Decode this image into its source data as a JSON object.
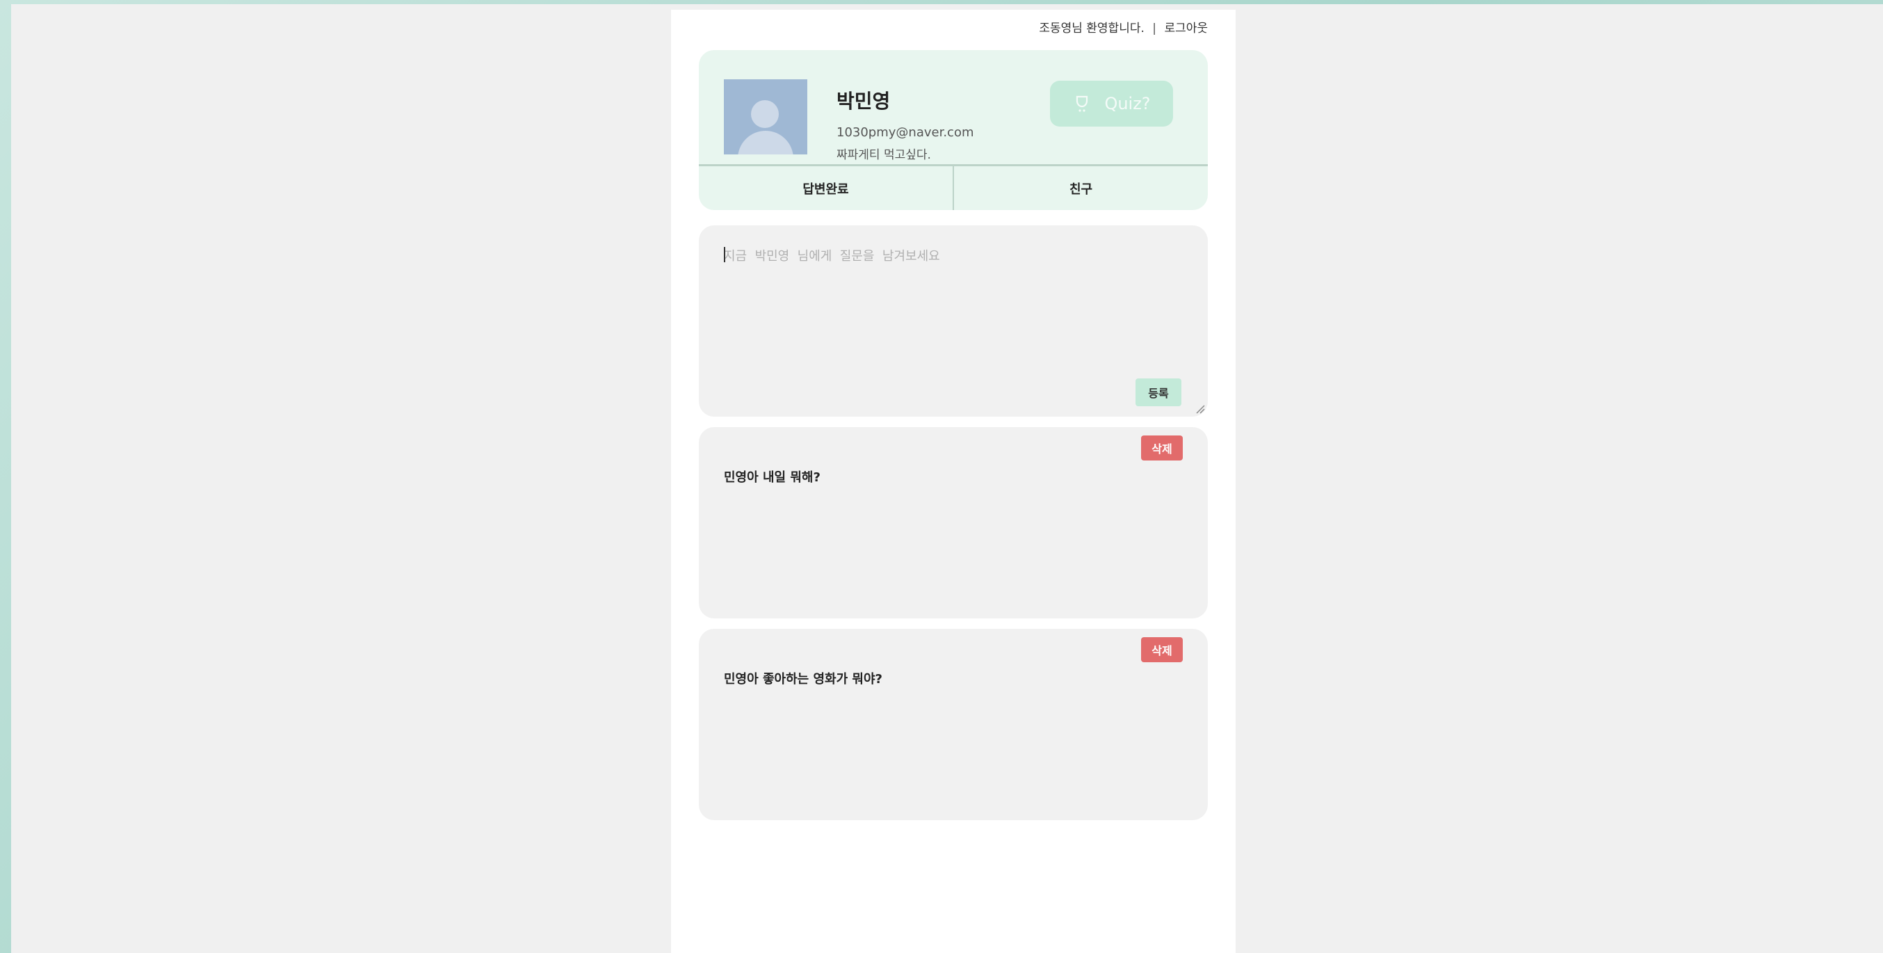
{
  "header": {
    "welcome": "조동영님 환영합니다.",
    "separator": "|",
    "logout": "로그아웃"
  },
  "profile": {
    "name": "박민영",
    "email": "1030pmy@naver.com",
    "bio": "짜파게티 먹고싶다.",
    "quiz_label": "Quiz?",
    "tabs": [
      {
        "label": "답변완료"
      },
      {
        "label": "친구"
      }
    ]
  },
  "ask": {
    "placeholder": "지금  박민영  님에게  질문을  남겨보세요",
    "value": "",
    "submit_label": "등록"
  },
  "questions": [
    {
      "text": "민영아 내일 뭐해?",
      "delete_label": "삭제"
    },
    {
      "text": "민영아 좋아하는 영화가 뭐야?",
      "delete_label": "삭제"
    }
  ],
  "colors": {
    "accent": "#c3ead9",
    "profile_bg": "#e8f6ef",
    "delete": "#e26b6b",
    "card_bg": "#f1f1f1"
  },
  "icons": {
    "quiz": "trophy-icon",
    "avatar": "user-silhouette-icon"
  }
}
